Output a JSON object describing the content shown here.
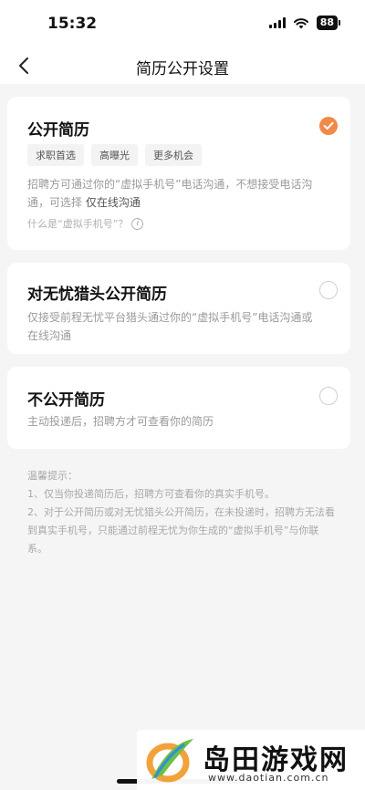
{
  "status_bar": {
    "time": "15:32",
    "battery": "88"
  },
  "nav": {
    "title": "简历公开设置"
  },
  "options": [
    {
      "title": "公开简历",
      "selected": true,
      "tags": [
        "求职首选",
        "高曝光",
        "更多机会"
      ],
      "desc_prefix": "招聘方可通过你的“虚拟手机号”电话沟通，不想接受电话沟通，可选择 ",
      "desc_emphasis": "仅在线沟通",
      "link": "什么是“虚拟手机号”？"
    },
    {
      "title": "对无忧猎头公开简历",
      "selected": false,
      "desc": "仅接受前程无忧平台猎头通过你的“虚拟手机号”电话沟通或在线沟通"
    },
    {
      "title": "不公开简历",
      "selected": false,
      "desc": "主动投递后，招聘方才可查看你的简历"
    }
  ],
  "tips": {
    "heading": "温馨提示：",
    "items": [
      "1、仅当你投递简历后，招聘方可查看你的真实手机号。",
      "2、对于公开简历或对无忧猎头公开简历，在未投递时，招聘方无法看到真实手机号，只能通过前程无忧为你生成的“虚拟手机号”与你联系。"
    ]
  },
  "watermark": {
    "name": "岛田游戏网",
    "url": "www.daotian.com.cn"
  },
  "colors": {
    "accent": "#ef8a4a",
    "page_bg": "#f5f5f5",
    "card_bg": "#ffffff"
  }
}
